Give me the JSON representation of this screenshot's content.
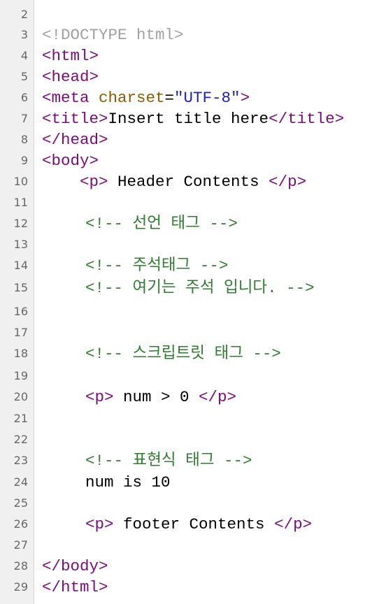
{
  "line_numbers": [
    "2",
    "3",
    "4",
    "5",
    "6",
    "7",
    "8",
    "9",
    "10",
    "11",
    "12",
    "13",
    "14",
    "15",
    "16",
    "17",
    "18",
    "19",
    "20",
    "21",
    "22",
    "23",
    "24",
    "25",
    "26",
    "27",
    "28",
    "29"
  ],
  "code": {
    "l3_doctype": "<!DOCTYPE html>",
    "l4_html_open": "<html>",
    "l5_head_open": "<head>",
    "l6_meta_open": "<meta ",
    "l6_attr": "charset",
    "l6_eq": "=",
    "l6_val": "\"UTF-8\"",
    "l6_close": ">",
    "l7_title_open": "<title>",
    "l7_text": "Insert title here",
    "l7_title_close": "</title>",
    "l8_head_close": "</head>",
    "l9_body_open": "<body>",
    "l10_indent": "    ",
    "l10_p_open": "<p>",
    "l10_text": " Header Contents ",
    "l10_p_close": "</p>",
    "l12_comment": "<!-- 선언 태그 -->",
    "l14_comment": "<!-- 주석태그 -->",
    "l15_comment": "<!-- 여기는 주석 입니다. -->",
    "l18_comment": "<!-- 스크립트릿 태그 -->",
    "l20_p_open": "<p>",
    "l20_text": " num > 0 ",
    "l20_p_close": "</p>",
    "l23_comment": "<!-- 표현식 태그 -->",
    "l24_text": "num is 10",
    "l26_p_open": "<p>",
    "l26_text": " footer Contents ",
    "l26_p_close": "</p>",
    "l28_body_close": "</body>",
    "l29_html_close": "</html>"
  },
  "colors": {
    "tag": "#7d0a7d",
    "attribute": "#8b5a00",
    "value": "#1f1fb8",
    "doctype": "#a0a0a0",
    "comment": "#2e7d2e",
    "gutter_bg": "#f0f0f0"
  }
}
